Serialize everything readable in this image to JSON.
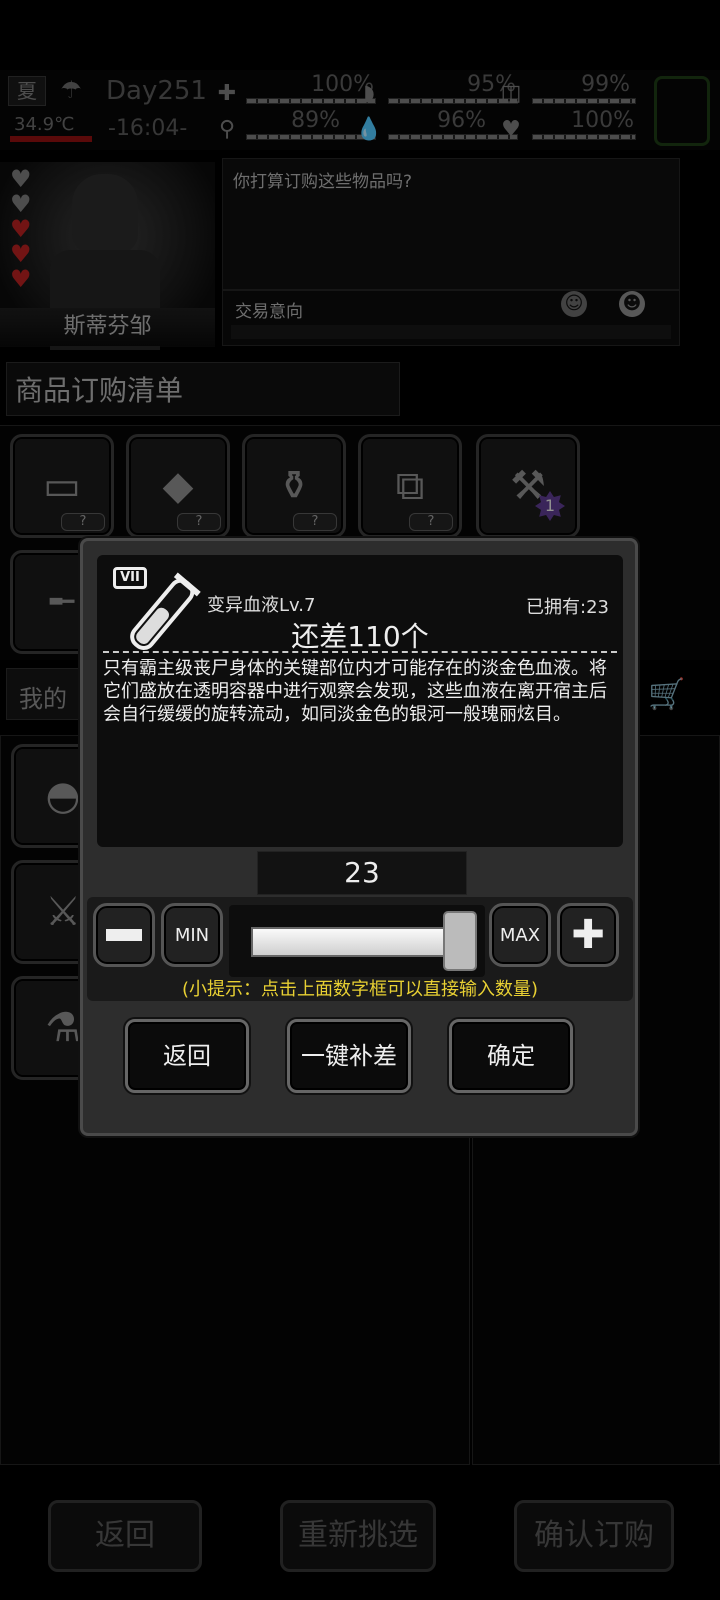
{
  "hud": {
    "season": "夏",
    "day": "Day251",
    "time": "-16:04-",
    "temperature": "34.9℃",
    "stats": [
      {
        "icon": "medkit-icon",
        "value": "100%",
        "level": 1.0
      },
      {
        "icon": "stomach-icon",
        "value": "95%",
        "level": 0.95
      },
      {
        "icon": "bladder-icon",
        "value": "99%",
        "level": 0.99
      },
      {
        "icon": "leg-icon",
        "value": "89%",
        "level": 0.89
      },
      {
        "icon": "water-drop-icon",
        "value": "96%",
        "level": 0.96
      },
      {
        "icon": "heart-icon",
        "value": "100%",
        "level": 1.0
      }
    ]
  },
  "npc": {
    "name": "斯蒂芬邹",
    "hearts": [
      "empty",
      "empty",
      "full",
      "full",
      "full"
    ],
    "dialog": "你打算订购这些物品吗?",
    "intent_label": "交易意向"
  },
  "order": {
    "title": "商品订购清单",
    "slots": [
      {
        "icon": "canned-food-icon",
        "qty": "?"
      },
      {
        "icon": "bread-icon",
        "qty": "?"
      },
      {
        "icon": "bottles-icon",
        "qty": "?"
      },
      {
        "icon": "bandage-roll-icon",
        "qty": "?"
      },
      {
        "icon": "scaffold-icon",
        "badge": "1"
      }
    ]
  },
  "my_section": {
    "tab_label": "我的"
  },
  "bottom": {
    "back": "返回",
    "reselect": "重新挑选",
    "confirm_order": "确认订购"
  },
  "modal": {
    "tier": "VII",
    "item_name": "变异血液Lv.7",
    "owned": "已拥有:23",
    "shortage": "还差110个",
    "description": "只有霸主级丧尸身体的关键部位内才可能存在的淡金色血液。将它们盛放在透明容器中进行观察会发现，这些血液在离开宿主后会自行缓缓的旋转流动，如同淡金色的银河一般瑰丽炫目。",
    "quantity": "23",
    "slider_fraction": 1.0,
    "min_label": "MIN",
    "max_label": "MAX",
    "tip": "(小提示：点击上面数字框可以直接输入数量)",
    "back": "返回",
    "fill_gap": "一键补差",
    "confirm": "确定"
  }
}
